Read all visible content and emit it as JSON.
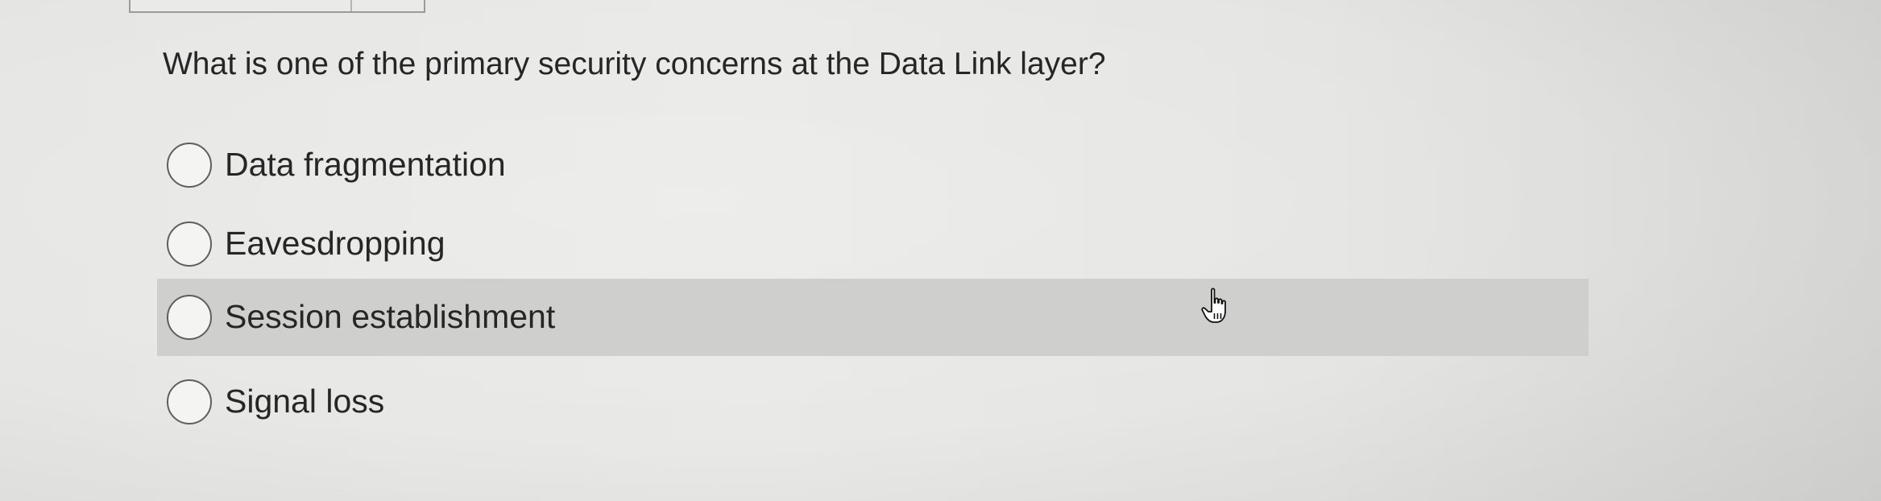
{
  "quiz": {
    "question": "What is one of the primary security concerns at the Data Link layer?",
    "options": [
      {
        "label": "Data fragmentation",
        "selected": false,
        "hovered": false
      },
      {
        "label": "Eavesdropping",
        "selected": false,
        "hovered": false
      },
      {
        "label": "Session establishment",
        "selected": false,
        "hovered": true
      },
      {
        "label": "Signal loss",
        "selected": false,
        "hovered": false
      }
    ]
  },
  "cursor": {
    "icon": "hand-pointer-icon"
  },
  "colors": {
    "hover_row": "#cfcfcd",
    "text": "#262626",
    "radio_border": "#5f5f5f"
  }
}
